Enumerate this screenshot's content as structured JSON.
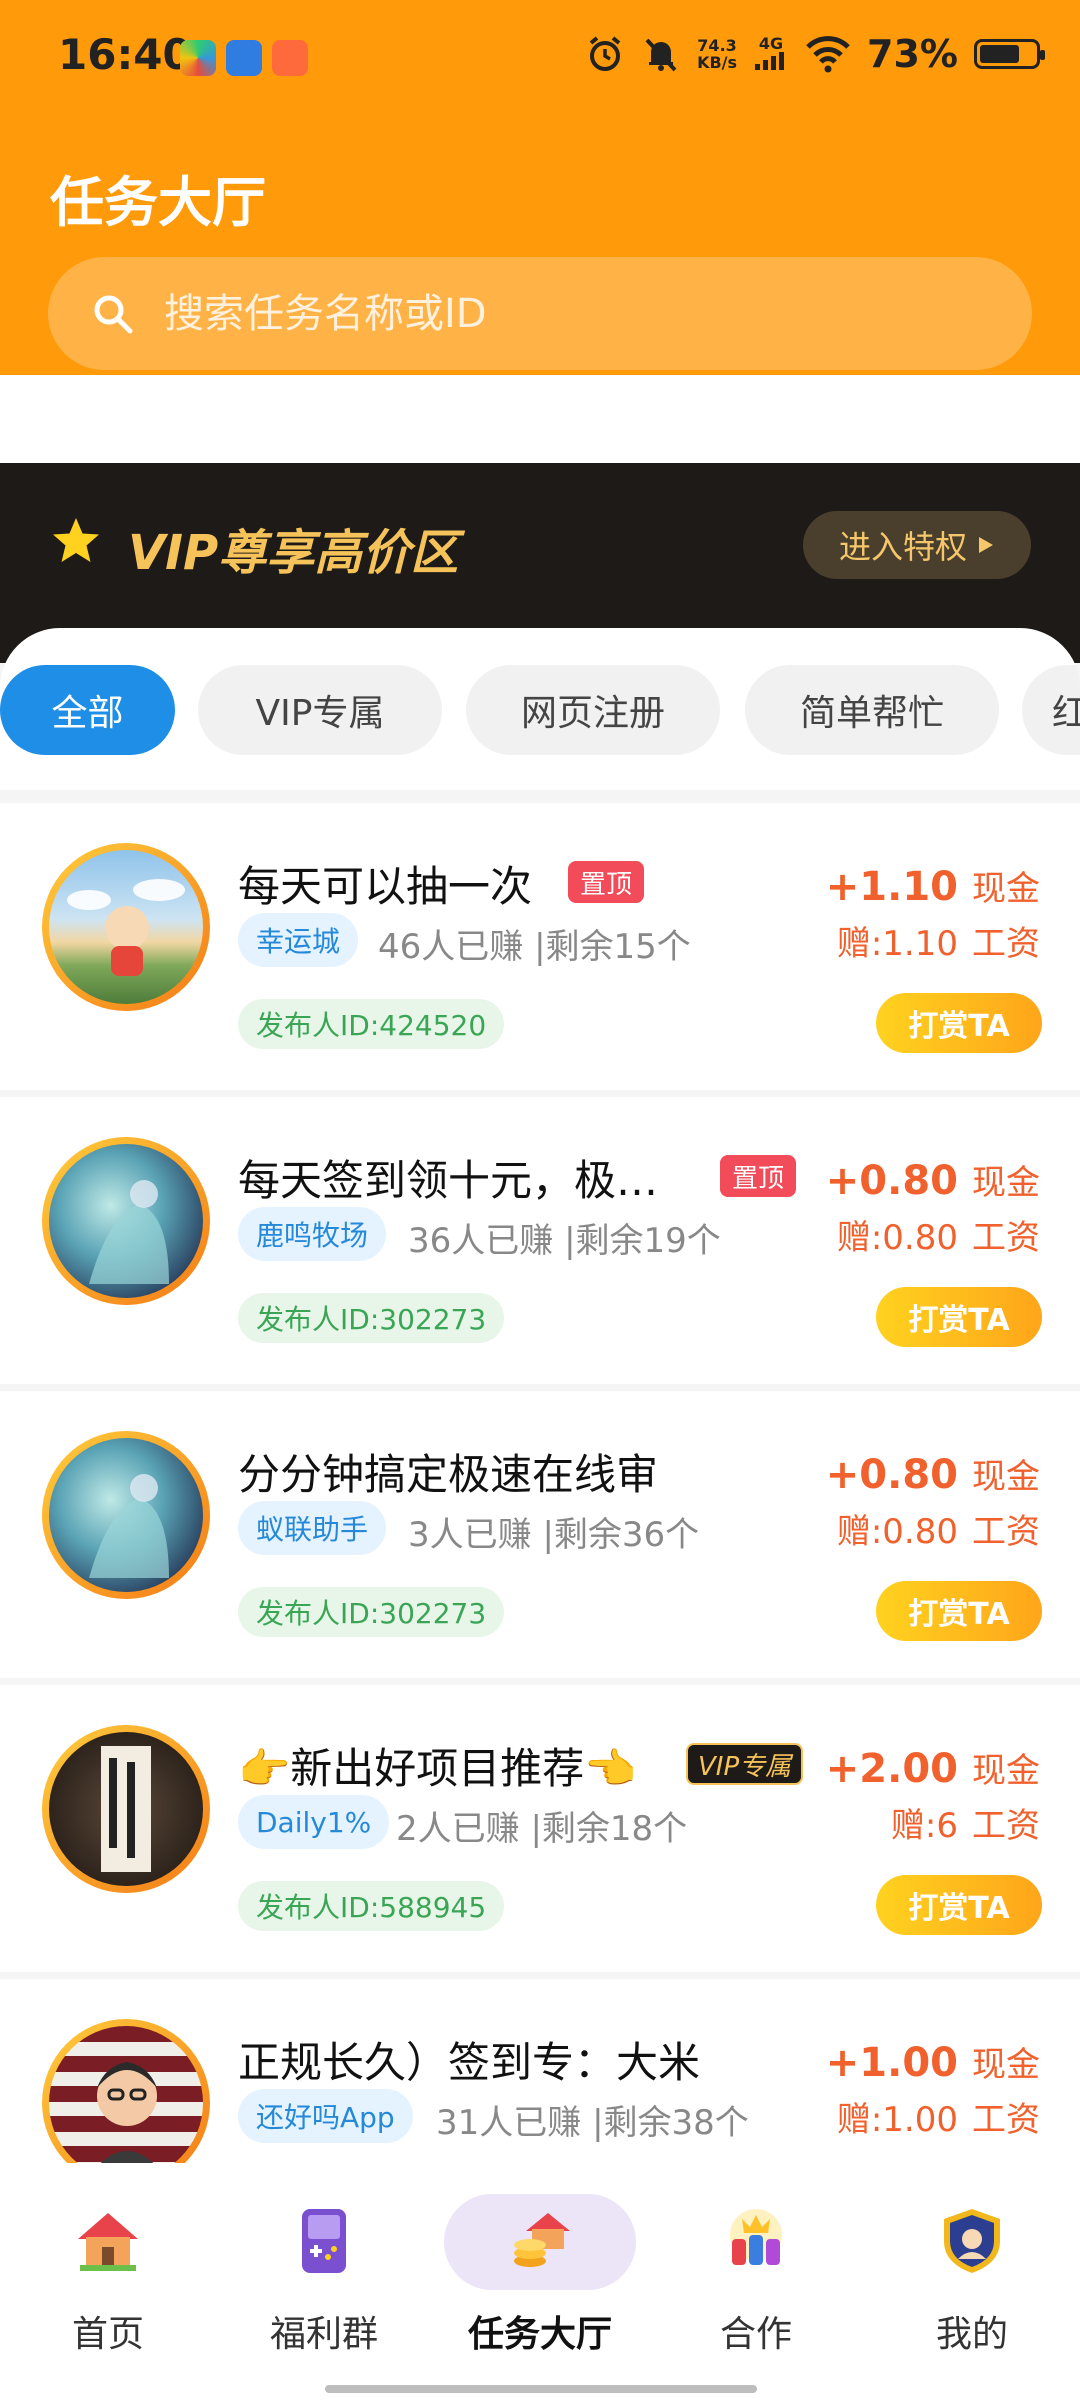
{
  "status_bar": {
    "time": "16:40",
    "net_speed_value": "74.3",
    "net_speed_unit": "KB/s",
    "network": "4G",
    "battery_percent_text": "73%",
    "battery_level": 0.73
  },
  "header": {
    "title": "任务大厅",
    "search_placeholder": "搜索任务名称或ID"
  },
  "vip_zone": {
    "title": "VIP尊享高价区",
    "enter_label": "进入特权"
  },
  "tabs": [
    {
      "label": "全部",
      "active": true
    },
    {
      "label": "VIP专属",
      "active": false
    },
    {
      "label": "网页注册",
      "active": false
    },
    {
      "label": "简单帮忙",
      "active": false
    },
    {
      "label": "红",
      "active": false
    }
  ],
  "tasks": [
    {
      "title": "每天可以抽一次",
      "badge": "置顶",
      "app": "幸运城",
      "earned": "46人已赚",
      "remaining": "|剩余15个",
      "publisher": "发布人ID:424520",
      "reward": "+1.10",
      "reward_unit": "现金",
      "bonus": "赠:1.10",
      "bonus_unit": "工资",
      "tip_label": "打赏TA"
    },
    {
      "title": "每天签到领十元，极…",
      "badge": "置顶",
      "app": "鹿鸣牧场",
      "earned": "36人已赚",
      "remaining": "|剩余19个",
      "publisher": "发布人ID:302273",
      "reward": "+0.80",
      "reward_unit": "现金",
      "bonus": "赠:0.80",
      "bonus_unit": "工资",
      "tip_label": "打赏TA"
    },
    {
      "title": "分分钟搞定极速在线审",
      "badge": "",
      "app": "蚁联助手",
      "earned": "3人已赚",
      "remaining": "|剩余36个",
      "publisher": "发布人ID:302273",
      "reward": "+0.80",
      "reward_unit": "现金",
      "bonus": "赠:0.80",
      "bonus_unit": "工资",
      "tip_label": "打赏TA"
    },
    {
      "title": "👉新出好项目推荐👈",
      "badge": "VIP专属",
      "app": "Daily1%",
      "earned": "2人已赚",
      "remaining": "|剩余18个",
      "publisher": "发布人ID:588945",
      "reward": "+2.00",
      "reward_unit": "现金",
      "bonus": "赠:6",
      "bonus_unit": "工资",
      "tip_label": "打赏TA"
    },
    {
      "title": "正规长久）签到专：大米",
      "badge": "",
      "app": "还好吗App",
      "earned": "31人已赚",
      "remaining": "|剩余38个",
      "publisher": "",
      "reward": "+1.00",
      "reward_unit": "现金",
      "bonus": "赠:1.00",
      "bonus_unit": "工资",
      "tip_label": ""
    }
  ],
  "bottom_nav": [
    {
      "label": "首页",
      "icon": "house-icon"
    },
    {
      "label": "福利群",
      "icon": "gameboy-icon"
    },
    {
      "label": "任务大厅",
      "icon": "task-hall-icon",
      "active": true
    },
    {
      "label": "合作",
      "icon": "crowd-icon"
    },
    {
      "label": "我的",
      "icon": "shield-avatar-icon"
    }
  ],
  "colors": {
    "header_orange": "#ff9a0a",
    "accent_blue": "#1f8ee6",
    "reward_orange": "#f0612d",
    "vip_gold": "#f5c35a",
    "vip_dark": "#1e1a17"
  }
}
